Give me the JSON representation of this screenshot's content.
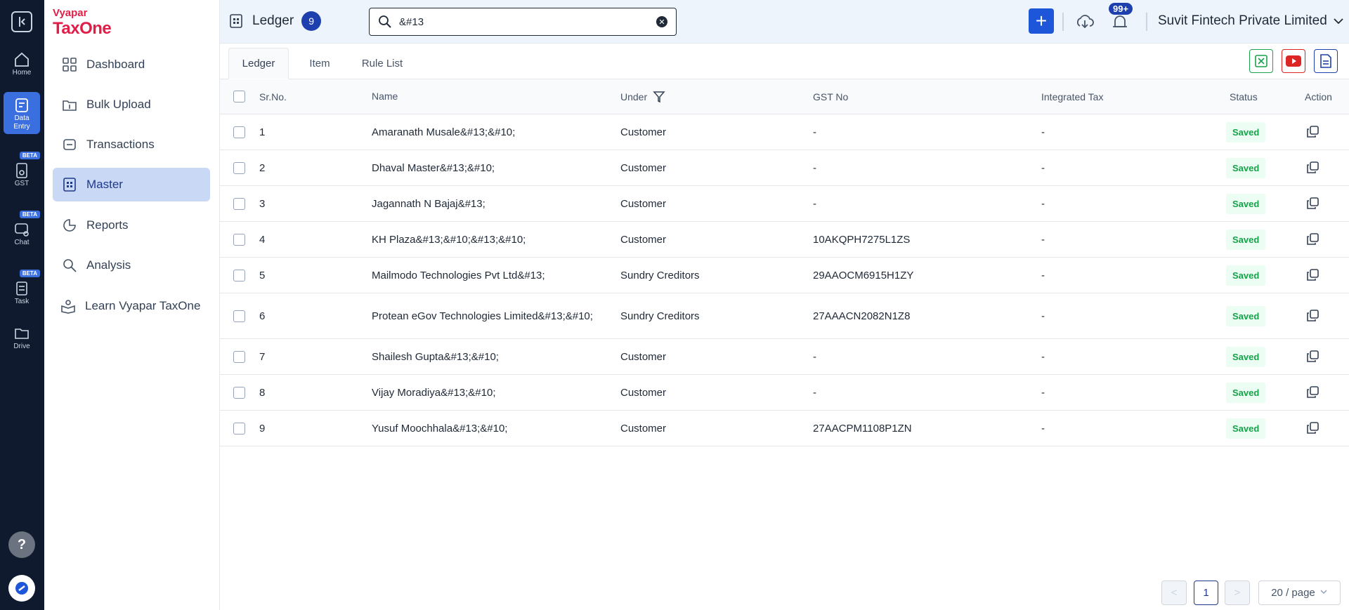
{
  "rail": {
    "items": [
      {
        "label": "Home",
        "icon": "home-icon"
      },
      {
        "label": "Data Entry",
        "icon": "data-entry-icon"
      },
      {
        "label": "GST",
        "icon": "gst-icon",
        "beta": "BETA"
      },
      {
        "label": "Chat",
        "icon": "chat-icon",
        "beta": "BETA"
      },
      {
        "label": "Task",
        "icon": "task-icon",
        "beta": "BETA"
      },
      {
        "label": "Drive",
        "icon": "drive-icon"
      }
    ],
    "help_label": "?"
  },
  "logo": {
    "line1": "Vyapar",
    "line2": "TaxOne"
  },
  "sidebar": {
    "items": [
      {
        "label": "Dashboard",
        "icon": "dashboard-icon"
      },
      {
        "label": "Bulk Upload",
        "icon": "upload-icon"
      },
      {
        "label": "Transactions",
        "icon": "transactions-icon"
      },
      {
        "label": "Master",
        "icon": "master-icon"
      },
      {
        "label": "Reports",
        "icon": "reports-icon"
      },
      {
        "label": "Analysis",
        "icon": "analysis-icon"
      },
      {
        "label": "Learn Vyapar TaxOne",
        "icon": "learn-icon"
      }
    ]
  },
  "header": {
    "title": "Ledger",
    "count": "9",
    "search_value": "&#13",
    "notif_count": "99+",
    "company": "Suvit Fintech Private Limited"
  },
  "tabs": [
    "Ledger",
    "Item",
    "Rule List"
  ],
  "table": {
    "headers": {
      "sr": "Sr.No.",
      "name": "Name",
      "under": "Under",
      "gst": "GST No",
      "tax": "Integrated Tax",
      "status": "Status",
      "action": "Action"
    },
    "rows": [
      {
        "sr": "1",
        "name": "Amaranath Musale&#13;&#10;",
        "under": "Customer",
        "gst": "-",
        "tax": "-",
        "status": "Saved"
      },
      {
        "sr": "2",
        "name": "Dhaval Master&#13;&#10;",
        "under": "Customer",
        "gst": "-",
        "tax": "-",
        "status": "Saved"
      },
      {
        "sr": "3",
        "name": "Jagannath N Bajaj&#13;",
        "under": "Customer",
        "gst": "-",
        "tax": "-",
        "status": "Saved"
      },
      {
        "sr": "4",
        "name": "KH Plaza&#13;&#10;&#13;&#10;",
        "under": "Customer",
        "gst": "10AKQPH7275L1ZS",
        "tax": "-",
        "status": "Saved"
      },
      {
        "sr": "5",
        "name": "Mailmodo Technologies Pvt Ltd&#13;",
        "under": "Sundry Creditors",
        "gst": "29AAOCM6915H1ZY",
        "tax": "-",
        "status": "Saved"
      },
      {
        "sr": "6",
        "name": "Protean eGov Technologies Limited&#13;&#10;",
        "under": "Sundry Creditors",
        "gst": "27AAACN2082N1Z8",
        "tax": "-",
        "status": "Saved"
      },
      {
        "sr": "7",
        "name": "Shailesh Gupta&#13;&#10;",
        "under": "Customer",
        "gst": "-",
        "tax": "-",
        "status": "Saved"
      },
      {
        "sr": "8",
        "name": "Vijay Moradiya&#13;&#10;",
        "under": "Customer",
        "gst": "-",
        "tax": "-",
        "status": "Saved"
      },
      {
        "sr": "9",
        "name": "Yusuf Moochhala&#13;&#10;",
        "under": "Customer",
        "gst": "27AACPM1108P1ZN",
        "tax": "-",
        "status": "Saved"
      }
    ]
  },
  "pagination": {
    "current": "1",
    "page_size": "20 / page"
  },
  "colors": {
    "accent": "#1e56d9",
    "rail_bg": "#0f1a2e",
    "saved": "#16a34a",
    "brand": "#e11d48"
  }
}
